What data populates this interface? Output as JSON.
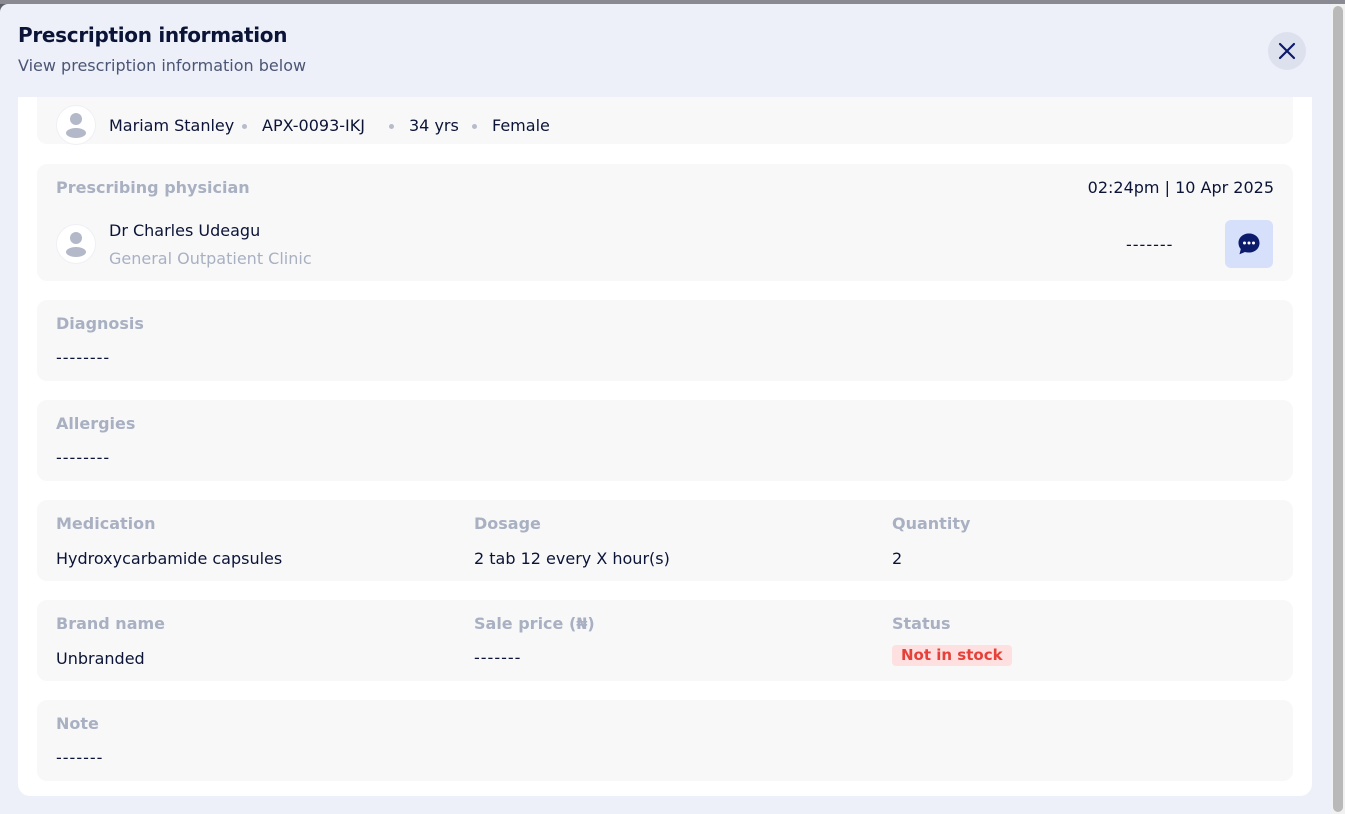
{
  "header": {
    "title": "Prescription information",
    "subtitle": "View prescription information below"
  },
  "patient": {
    "name": "Mariam Stanley",
    "id": "APX-0093-IKJ",
    "age": "34 yrs",
    "gender": "Female"
  },
  "physician": {
    "section_label": "Prescribing physician",
    "timestamp": "02:24pm | 10 Apr 2025",
    "name": "Dr Charles Udeagu",
    "clinic": "General Outpatient Clinic",
    "contact": "-------"
  },
  "diagnosis": {
    "label": "Diagnosis",
    "value": "--------"
  },
  "allergies": {
    "label": "Allergies",
    "value": "--------"
  },
  "medication": {
    "label": "Medication",
    "value": "Hydroxycarbamide capsules",
    "dosage_label": "Dosage",
    "dosage_value": "2 tab 12 every X hour(s)",
    "quantity_label": "Quantity",
    "quantity_value": "2"
  },
  "brand": {
    "label": "Brand name",
    "value": "Unbranded",
    "price_label": "Sale price (₦)",
    "price_value": "-------",
    "status_label": "Status",
    "status_value": "Not in stock"
  },
  "note": {
    "label": "Note",
    "value": "-------"
  },
  "icons": {
    "close": "close-icon",
    "avatar": "user-avatar-icon",
    "chat": "chat-bubble-icon"
  },
  "colors": {
    "brand": "#0d1b6b",
    "status_bg": "#fde0df",
    "status_text": "#e5413a"
  }
}
